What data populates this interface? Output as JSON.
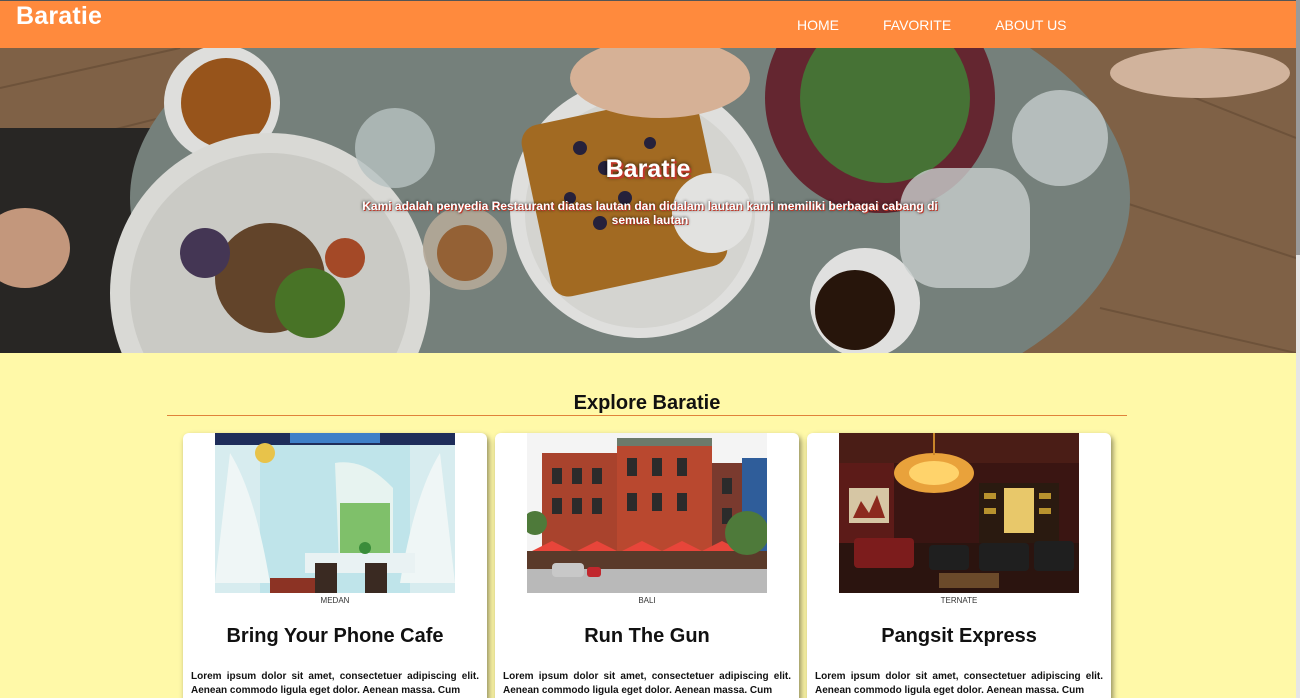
{
  "navbar": {
    "brand": "Baratie",
    "links": [
      "HOME",
      "FAVORITE",
      "ABOUT US"
    ]
  },
  "hero": {
    "title": "Baratie",
    "subtitle": "Kami adalah penyedia Restaurant diatas lautan dan didalam lautan kami memiliki berbagai cabang di semua lautan"
  },
  "explore": {
    "title": "Explore Baratie",
    "cards": [
      {
        "location": "MEDAN",
        "name": "Bring Your Phone Cafe",
        "text": "Lorem ipsum dolor sit amet, consectetuer adipiscing elit. Aenean commodo ligula eget dolor. Aenean massa. Cum"
      },
      {
        "location": "BALI",
        "name": "Run The Gun",
        "text": "Lorem ipsum dolor sit amet, consectetuer adipiscing elit. Aenean commodo ligula eget dolor. Aenean massa. Cum"
      },
      {
        "location": "TERNATE",
        "name": "Pangsit Express",
        "text": "Lorem ipsum dolor sit amet, consectetuer adipiscing elit. Aenean commodo ligula eget dolor. Aenean massa. Cum"
      }
    ]
  },
  "colors": {
    "navbar": "#ff8a3d",
    "page_background": "#fff9a8",
    "accent_rule": "#e0833a"
  }
}
